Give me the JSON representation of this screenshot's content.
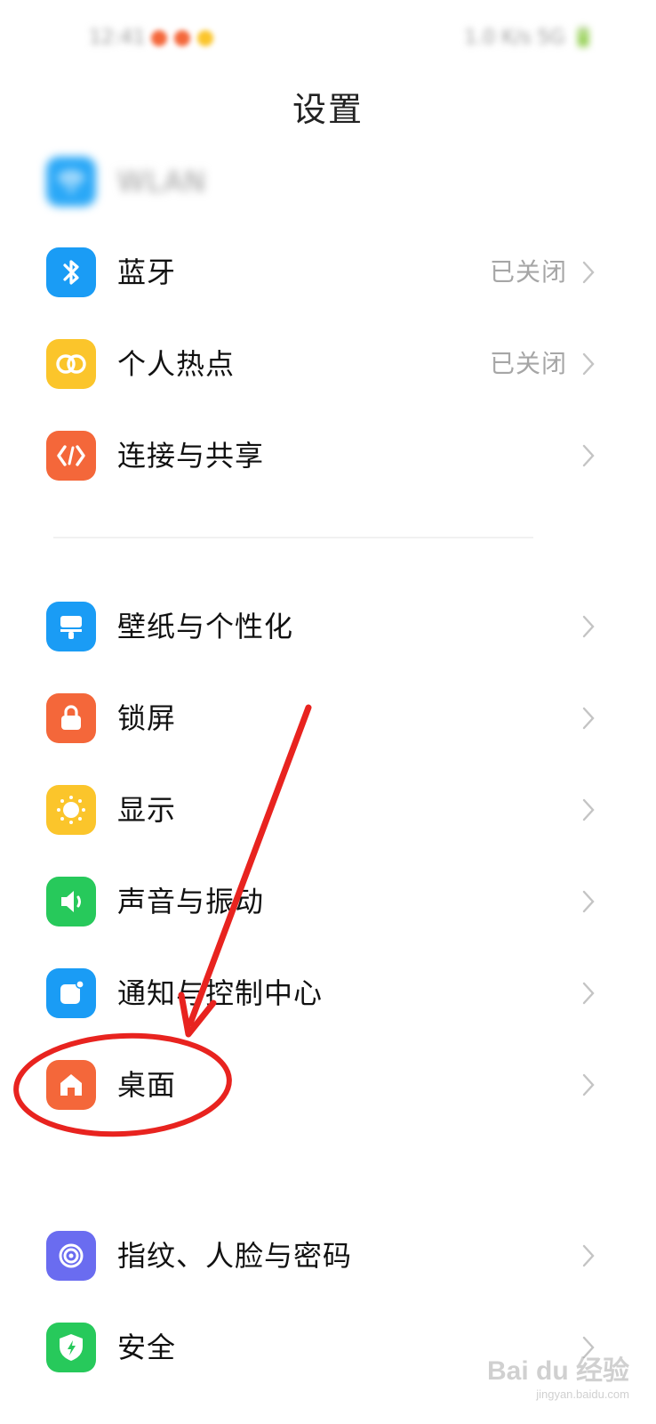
{
  "status_bar": {
    "time": "12:41",
    "right": "1.0 K/s 5G 🔋"
  },
  "header": {
    "title": "设置"
  },
  "settings": [
    {
      "label": "WLAN",
      "value": "",
      "icon": "wifi-icon",
      "color": "#2aa8f7"
    },
    {
      "label": "蓝牙",
      "value": "已关闭",
      "icon": "bluetooth-icon",
      "color": "#1a9cf5"
    },
    {
      "label": "个人热点",
      "value": "已关闭",
      "icon": "hotspot-icon",
      "color": "#fbc52b"
    },
    {
      "label": "连接与共享",
      "value": "",
      "icon": "share-icon",
      "color": "#f4673a"
    },
    {
      "label": "壁纸与个性化",
      "value": "",
      "icon": "wallpaper-icon",
      "color": "#1a9cf5"
    },
    {
      "label": "锁屏",
      "value": "",
      "icon": "lock-icon",
      "color": "#f4673a"
    },
    {
      "label": "显示",
      "value": "",
      "icon": "sun-icon",
      "color": "#fbc52b"
    },
    {
      "label": "声音与振动",
      "value": "",
      "icon": "speaker-icon",
      "color": "#27c95b"
    },
    {
      "label": "通知与控制中心",
      "value": "",
      "icon": "notification-icon",
      "color": "#1a9cf5"
    },
    {
      "label": "桌面",
      "value": "",
      "icon": "home-icon",
      "color": "#f4673a"
    },
    {
      "label": "指纹、人脸与密码",
      "value": "",
      "icon": "fingerprint-icon",
      "color": "#6a6cf0"
    },
    {
      "label": "安全",
      "value": "",
      "icon": "shield-icon",
      "color": "#27c95b"
    }
  ],
  "annotation": {
    "highlight_color": "#e8231f"
  },
  "watermark": {
    "text": "Bai du 经验",
    "sub": "jingyan.baidu.com"
  }
}
